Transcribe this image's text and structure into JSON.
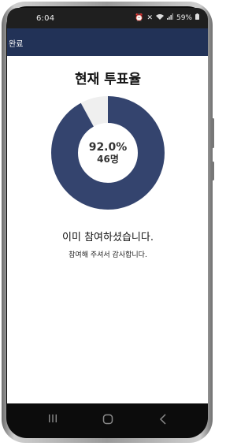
{
  "status_bar": {
    "time": "6:04",
    "battery": "59%"
  },
  "app_bar": {
    "done_label": "완료"
  },
  "vote": {
    "title": "현재 투표율",
    "percent_text": "92.0%",
    "count_text": "46명",
    "rate": 0.92,
    "colors": {
      "filled": "#34446e",
      "remaining": "#efefef"
    }
  },
  "messages": {
    "primary": "이미 참여하셨습니다.",
    "secondary": "참여해 주셔서 감사합니다."
  },
  "nav": {
    "icons": [
      "recent-apps-icon",
      "home-icon",
      "back-icon"
    ]
  }
}
